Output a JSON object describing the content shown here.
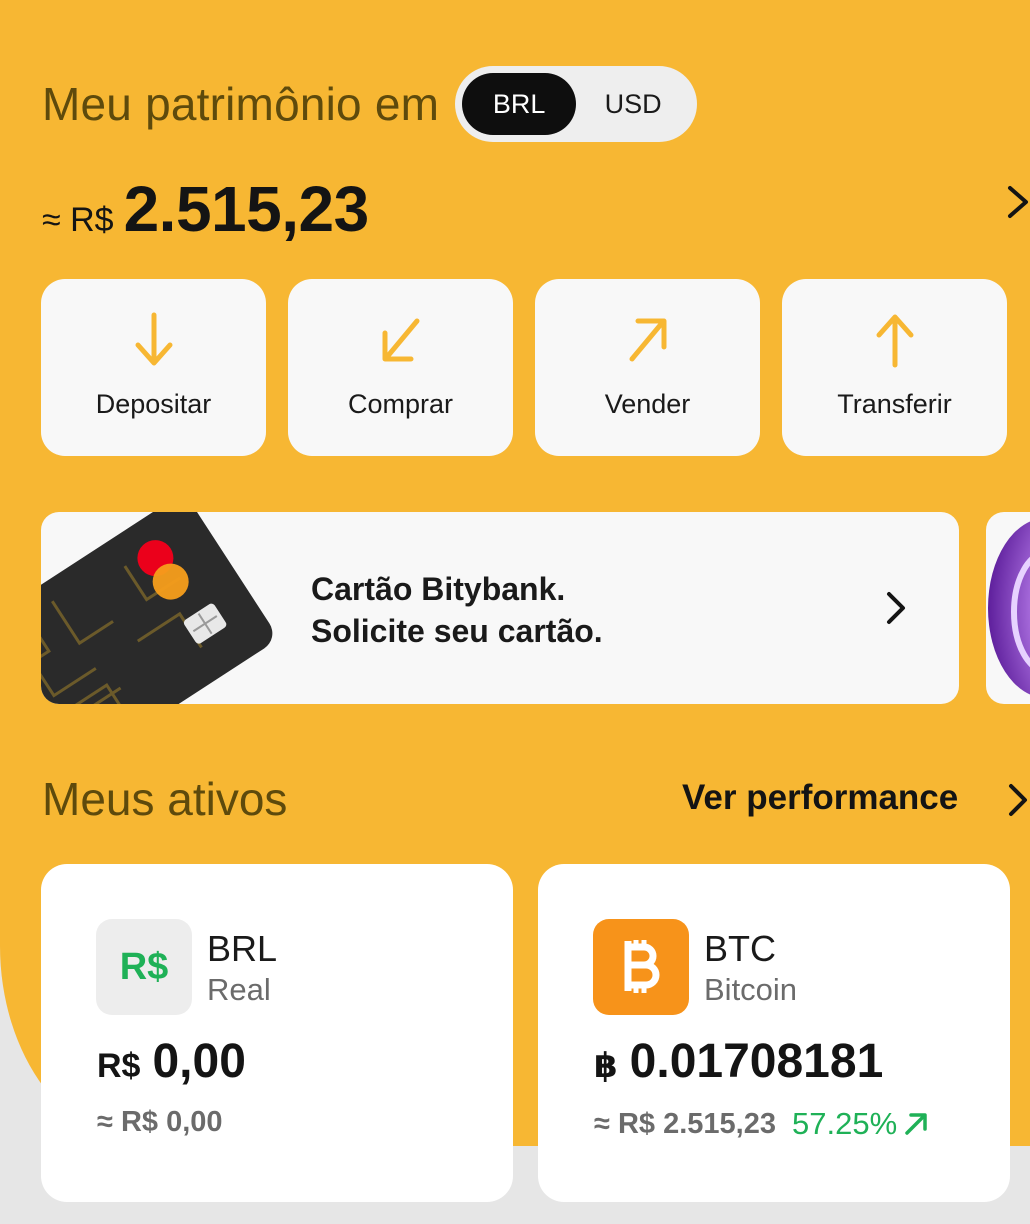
{
  "header": {
    "title": "Meu patrimônio em",
    "currency_options": [
      "BRL",
      "USD"
    ],
    "selected_currency": "BRL"
  },
  "balance": {
    "prefix": "≈ R$",
    "value": "2.515,23"
  },
  "actions": [
    {
      "label": "Depositar",
      "icon": "arrow-down-icon"
    },
    {
      "label": "Comprar",
      "icon": "arrow-down-left-icon"
    },
    {
      "label": "Vender",
      "icon": "arrow-up-right-icon"
    },
    {
      "label": "Transferir",
      "icon": "arrow-up-icon"
    }
  ],
  "promo": {
    "line1": "Cartão Bitybank.",
    "line2": "Solicite seu cartão."
  },
  "assets_section": {
    "title": "Meus ativos",
    "link": "Ver performance"
  },
  "assets": [
    {
      "logo_text": "R$",
      "code": "BRL",
      "name": "Real",
      "symbol": "R$",
      "amount": "0,00",
      "approx": "≈ R$ 0,00",
      "change": ""
    },
    {
      "logo_text": "₿",
      "code": "BTC",
      "name": "Bitcoin",
      "symbol": "฿",
      "amount": "0.01708181",
      "approx": "≈ R$ 2.515,23",
      "change": "57.25%"
    }
  ],
  "colors": {
    "background": "#f7b733",
    "accent_icon": "#f7b733",
    "btc_orange": "#f7931a",
    "positive_green": "#1fb157",
    "title_brown": "#5e4a0c"
  }
}
